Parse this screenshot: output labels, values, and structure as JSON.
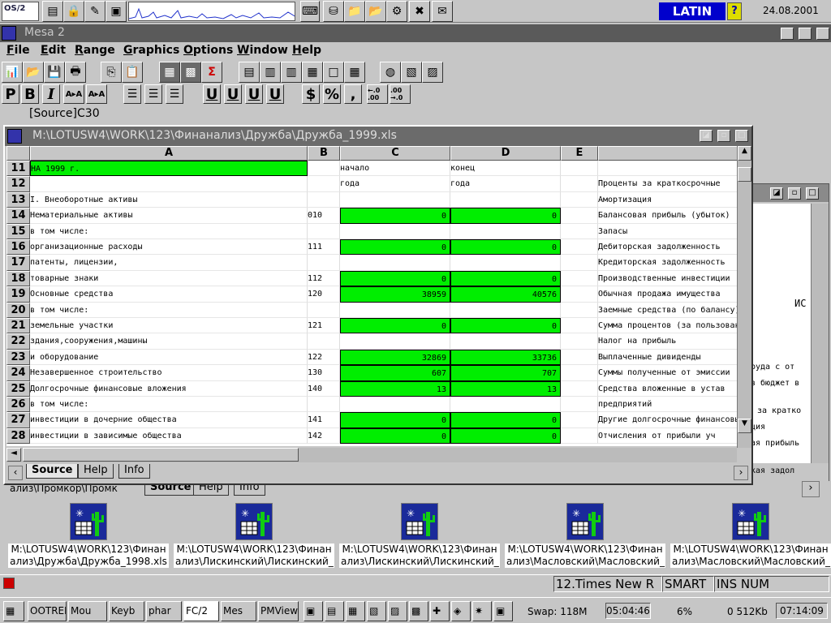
{
  "top_bar": {
    "language": "LATIN",
    "date": "24.08.2001",
    "os_logo": "OS/2"
  },
  "app": {
    "title": "Mesa 2",
    "menus": [
      "File",
      "Edit",
      "Range",
      "Graphics",
      "Options",
      "Window",
      "Help"
    ],
    "format_buttons": {
      "p": "P",
      "b": "B",
      "i": "I",
      "aa_small": "A▸A",
      "aa_big": "A▸A",
      "u1": "U",
      "u2": "U",
      "u3": "U",
      "u4": "U",
      "dollar": "$",
      "percent": "%",
      "comma": ",",
      "dec_add": "←.0 .00",
      "dec_rem": ".00 →.0"
    },
    "cell_ref": "[Source]C30"
  },
  "back_window": {
    "right_texts": [
      "ИС",
      "руда с от",
      "в бюджет в",
      "за кратко",
      "ция",
      "ая прибыль",
      "кая задол"
    ],
    "tabs": [
      "Source",
      "Help",
      "Info"
    ],
    "tab_caption": "ализ\\Промкор\\Промк"
  },
  "sheet": {
    "title": "M:\\LOTUSW4\\WORK\\123\\Финанализ\\Дружба\\Дружба_1999.xls",
    "columns": [
      "A",
      "B",
      "C",
      "D",
      "E"
    ],
    "rows": [
      {
        "n": "11",
        "a": "НА   1999  г.",
        "b": "",
        "c": "начало",
        "d": "конец",
        "g": "",
        "f": ""
      },
      {
        "n": "12",
        "a": "",
        "b": "",
        "c": "года",
        "d": "года",
        "g": "",
        "f": "Проценты за краткосрочные"
      },
      {
        "n": "13",
        "a": "I. Внеоборотные активы",
        "b": "",
        "c": "",
        "d": "",
        "g": "",
        "f": "Амортизация"
      },
      {
        "n": "14",
        "a": "Нематериальные активы",
        "b": "010",
        "c": "0",
        "d": "0",
        "g": "g",
        "f": "Балансовая прибыль (убыток)"
      },
      {
        "n": "15",
        "a": "  в том числе:",
        "b": "",
        "c": "",
        "d": "",
        "g": "",
        "f": "Запасы"
      },
      {
        "n": "16",
        "a": "  организационные расходы",
        "b": "111",
        "c": "0",
        "d": "0",
        "g": "g",
        "f": "Дебиторская задолженность"
      },
      {
        "n": "17",
        "a": "  патенты, лицензии,",
        "b": "",
        "c": "",
        "d": "",
        "g": "",
        "f": "Кредиторская задолженность"
      },
      {
        "n": "18",
        "a": "  товарные знаки",
        "b": "112",
        "c": "0",
        "d": "0",
        "g": "g",
        "f": "Производственные инвестиции"
      },
      {
        "n": "19",
        "a": "Основные средства",
        "b": "120",
        "c": "38959",
        "d": "40576",
        "g": "g",
        "f": "Обычная продажа имущества"
      },
      {
        "n": "20",
        "a": "       в том числе:",
        "b": "",
        "c": "",
        "d": "",
        "g": "",
        "f": "Заемные средства (по балансу)"
      },
      {
        "n": "21",
        "a": "  земельные участки",
        "b": "121",
        "c": "0",
        "d": "0",
        "g": "g",
        "f": "Сумма процентов (за пользование)"
      },
      {
        "n": "22",
        "a": "  здания,сооружения,машины",
        "b": "",
        "c": "",
        "d": "",
        "g": "",
        "f": "Налог на прибыль"
      },
      {
        "n": "23",
        "a": "  и оборудование",
        "b": "122",
        "c": "32869",
        "d": "33736",
        "g": "g",
        "f": "Выплаченные дивиденды"
      },
      {
        "n": "24",
        "a": "Незавершенное строительство",
        "b": "130",
        "c": "607",
        "d": "707",
        "g": "g",
        "f": "Суммы полученные от эмиссии"
      },
      {
        "n": "25",
        "a": "Долгосрочные финансовые вложения",
        "b": "140",
        "c": "13",
        "d": "13",
        "g": "g",
        "f": "Средства вложенные в устав"
      },
      {
        "n": "26",
        "a": "      в том числе:",
        "b": "",
        "c": "",
        "d": "",
        "g": "",
        "f": " предприятий"
      },
      {
        "n": "27",
        "a": "  инвестиции в дочерние общества",
        "b": "141",
        "c": "0",
        "d": "0",
        "g": "g",
        "f": "Другие долгосрочные финансовые"
      },
      {
        "n": "28",
        "a": "  инвестиции в зависимые общества",
        "b": "142",
        "c": "0",
        "d": "0",
        "g": "g",
        "f": "Отчисления от прибыли уч"
      }
    ],
    "tabs": [
      "Source",
      "Help",
      "Info"
    ]
  },
  "desktop_icons": [
    {
      "label": "M:\\LOTUSW4\\WORK\\123\\Финан\nализ\\Дружба\\Дружба_1998.xls"
    },
    {
      "label": "M:\\LOTUSW4\\WORK\\123\\Финан\nализ\\Лискинский\\Лискинский_"
    },
    {
      "label": "M:\\LOTUSW4\\WORK\\123\\Финан\nализ\\Лискинский\\Лискинский_"
    },
    {
      "label": "M:\\LOTUSW4\\WORK\\123\\Финан\nализ\\Масловский\\Масловский_"
    },
    {
      "label": "M:\\LOTUSW4\\WORK\\123\\Финан\nализ\\Масловский\\Масловский_"
    }
  ],
  "status": {
    "font": "12.Times New R",
    "mode": "SMART",
    "keys": "INS NUM"
  },
  "taskbar": {
    "items": [
      "OOTREE",
      "Mou",
      "Keyb",
      "phar",
      "FC/2",
      "Mes",
      "PMView"
    ],
    "swap": "Swap: 118M",
    "time1": "05:04:46",
    "cpu": "6%",
    "memory": "0 512Kb",
    "clock": "07:14:09"
  },
  "colors": {
    "cell_green": "#00ee00",
    "titlebar_active": "#5a5a5a",
    "latin_bg": "#0000cc"
  }
}
